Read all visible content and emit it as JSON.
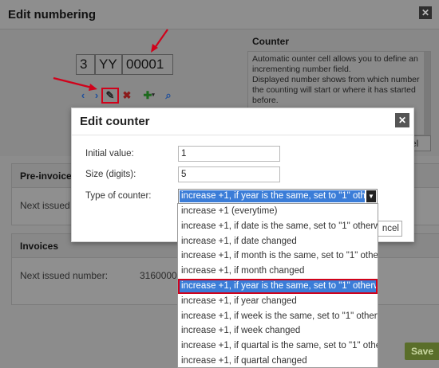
{
  "numbering_dialog": {
    "title": "Edit numbering",
    "segments": [
      "3",
      "YY",
      "00001"
    ],
    "counter_panel": {
      "title": "Counter",
      "description": "Automatic ounter cell allows you to define an incrementing number field.\nDisplayed number shows from which number the counting will start or where it has started before."
    },
    "close_button_partial": "cel"
  },
  "background_page": {
    "preinvoices": {
      "title": "Pre-invoices",
      "row_label": "Next issued nu"
    },
    "invoices": {
      "title": "Invoices",
      "row_label": "Next issued number:",
      "row_value": "31600001"
    },
    "save_button_partial": "Save"
  },
  "counter_modal": {
    "title": "Edit counter",
    "initial_value_label": "Initial value:",
    "initial_value": "1",
    "size_label": "Size (digits):",
    "size_value": "5",
    "type_label": "Type of counter:",
    "type_selected": "increase +1, if year is the same, set to \"1\" otherwise",
    "cancel_partial": "ncel"
  },
  "dropdown_options": [
    "increase +1 (everytime)",
    "increase +1, if date is the same, set to \"1\" otherwise",
    "increase +1, if date changed",
    "increase +1, if month is the same, set to \"1\" other...",
    "increase +1, if month changed",
    "increase +1, if year is the same, set to \"1\" otherwise",
    "increase +1, if year changed",
    "increase +1, if week is the same, set to \"1\" otherwi...",
    "increase +1, if week changed",
    "increase +1, if quartal is the same, set to \"1\" othe...",
    "increase +1, if quartal changed"
  ],
  "selected_option_index": 5,
  "colors": {
    "accent": "#3b7dd8",
    "highlight": "#d0021b"
  }
}
